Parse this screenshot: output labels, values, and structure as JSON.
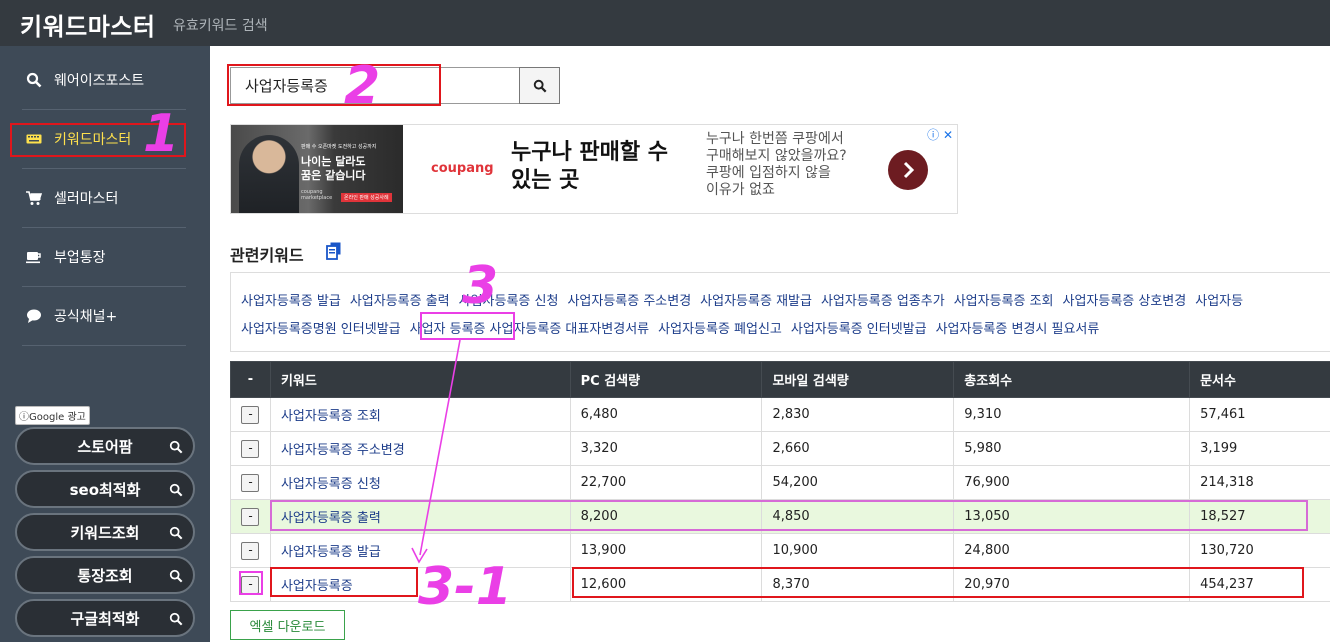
{
  "header": {
    "title": "키워드마스터",
    "subtitle": "유효키워드 검색"
  },
  "sidebar": {
    "items": [
      {
        "label": "웨어이즈포스트",
        "icon": "search-icon",
        "active": false
      },
      {
        "label": "키워드마스터",
        "icon": "keyboard-icon",
        "active": true
      },
      {
        "label": "셀러마스터",
        "icon": "cart-icon",
        "active": false
      },
      {
        "label": "부업통장",
        "icon": "coffee-icon",
        "active": false
      },
      {
        "label": "공식채널+",
        "icon": "chat-icon",
        "active": false
      }
    ],
    "ad_badge": "ⓘGoogle 광고",
    "ad_links": [
      "스토어팜",
      "seo최적화",
      "키워드조회",
      "통장조회",
      "구글최적화"
    ]
  },
  "search": {
    "value": "사업자등록증"
  },
  "ad": {
    "image_caption": "판매 수 오픈마켓 도전하고 성공까지",
    "image_title": "나이는 달라도\n꿈은 같습니다",
    "image_brand": "coupang marketplace",
    "image_badge": "온라인 판매 성공사례",
    "brand": "coupang",
    "headline": "누구나 판매할 수 있는 곳",
    "body": "누구나 한번쯤 쿠팡에서\n구매해보지 않았을까요?\n쿠팡에 입점하지 않을\n이유가 없죠",
    "close": "ⓘ ✕"
  },
  "related": {
    "title": "관련키워드",
    "line1": [
      "사업자등록증 발급",
      "사업자등록증 출력",
      "사업자등록증 신청",
      "사업자등록증 주소변경",
      "사업자등록증 재발급",
      "사업자등록증 업종추가",
      "사업자등록증 조회",
      "사업자등록증 상호변경",
      "사업자등"
    ],
    "line2": [
      "사업자등록증명원 인터넷발급",
      "사업자 등록증",
      "사업자등록증 대표자변경서류",
      "사업자등록증 폐업신고",
      "사업자등록증 인터넷발급",
      "사업자등록증 변경시 필요서류"
    ]
  },
  "table": {
    "headers": [
      "-",
      "키워드",
      "PC 검색량",
      "모바일 검색량",
      "총조회수",
      "문서수"
    ],
    "rows": [
      {
        "btn": "-",
        "keyword": "사업자등록증 조회",
        "pc": "6,480",
        "mobile": "2,830",
        "total": "9,310",
        "docs": "57,461"
      },
      {
        "btn": "-",
        "keyword": "사업자등록증 주소변경",
        "pc": "3,320",
        "mobile": "2,660",
        "total": "5,980",
        "docs": "3,199"
      },
      {
        "btn": "-",
        "keyword": "사업자등록증 신청",
        "pc": "22,700",
        "mobile": "54,200",
        "total": "76,900",
        "docs": "214,318"
      },
      {
        "btn": "-",
        "keyword": "사업자등록증 출력",
        "pc": "8,200",
        "mobile": "4,850",
        "total": "13,050",
        "docs": "18,527"
      },
      {
        "btn": "-",
        "keyword": "사업자등록증 발급",
        "pc": "13,900",
        "mobile": "10,900",
        "total": "24,800",
        "docs": "130,720"
      },
      {
        "btn": "-",
        "keyword": "사업자등록증",
        "pc": "12,600",
        "mobile": "8,370",
        "total": "20,970",
        "docs": "454,237"
      }
    ]
  },
  "excel_button": "엑셀 다운로드",
  "annotations": {
    "n1": "1",
    "n2": "2",
    "n3": "3",
    "n31": "3-1",
    "red": "#e0161c",
    "magenta": "#ea3fe6"
  }
}
